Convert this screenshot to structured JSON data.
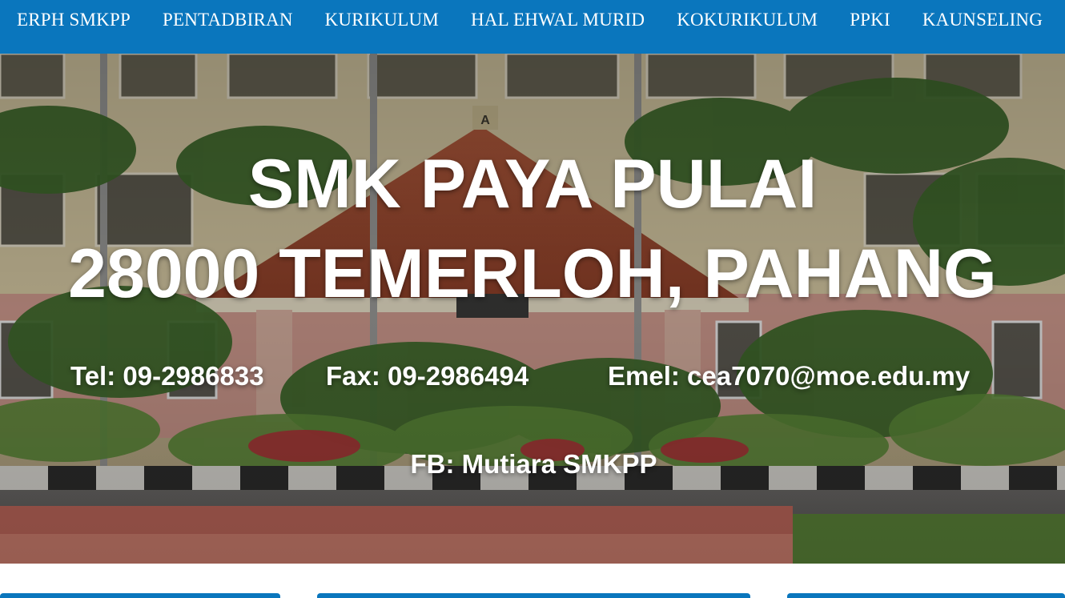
{
  "nav": {
    "items": [
      {
        "label": "ERPH SMKPP"
      },
      {
        "label": "PENTADBIRAN"
      },
      {
        "label": "KURIKULUM"
      },
      {
        "label": "HAL EHWAL MURID"
      },
      {
        "label": "KOKURIKULUM"
      },
      {
        "label": "PPKI"
      },
      {
        "label": "KAUNSELING"
      }
    ],
    "background": "#0a76bd"
  },
  "hero": {
    "title_line1": "SMK PAYA PULAI",
    "title_line2": "28000 TEMERLOH, PAHANG",
    "tel": "Tel: 09-2986833",
    "fax": "Fax: 09-2986494",
    "email": "Emel: cea7070@moe.edu.my",
    "fb": "FB: Mutiara SMKPP",
    "building_sign": "A"
  },
  "colors": {
    "accent": "#0a76bd",
    "text_on_hero": "#ffffff"
  }
}
